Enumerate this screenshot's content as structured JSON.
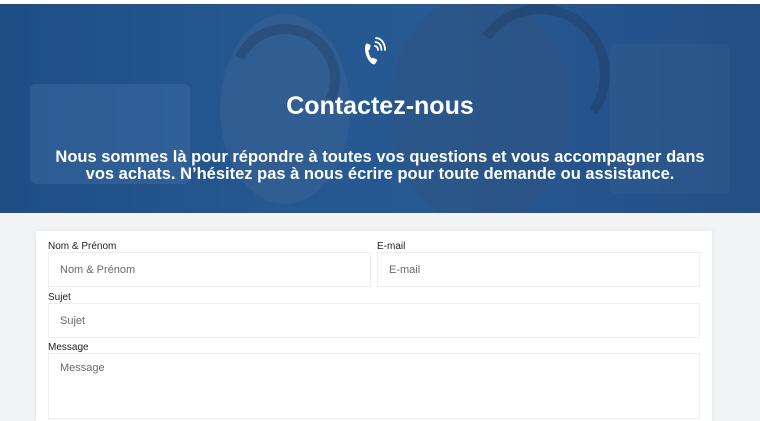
{
  "hero": {
    "title": "Contactez-nous",
    "subtitle": "Nous sommes là pour répondre à toutes vos questions et vous accompagner dans vos achats. N’hésitez pas à nous écrire pour toute demande ou assistance.",
    "icon": "phone-ringing-icon"
  },
  "form": {
    "name": {
      "label": "Nom & Prénom",
      "placeholder": "Nom & Prénom"
    },
    "email": {
      "label": "E-mail",
      "placeholder": "E-mail"
    },
    "subject": {
      "label": "Sujet",
      "placeholder": "Sujet"
    },
    "message": {
      "label": "Message",
      "placeholder": "Message"
    }
  },
  "colors": {
    "hero_blue": "#2a5a90",
    "text_white": "#ffffff",
    "page_bg": "#f2f4f6"
  }
}
